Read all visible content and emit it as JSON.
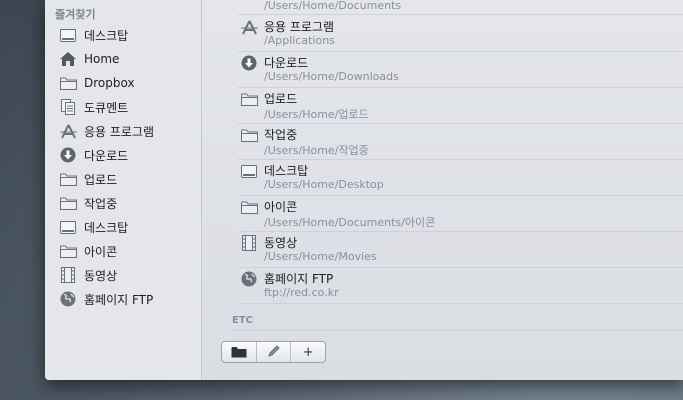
{
  "sidebar": {
    "heading": "즐겨찾기",
    "items": [
      {
        "label": "데스크탑",
        "icon": "desktop-icon"
      },
      {
        "label": "Home",
        "icon": "home-icon"
      },
      {
        "label": "Dropbox",
        "icon": "folder-icon"
      },
      {
        "label": "도큐멘트",
        "icon": "documents-icon"
      },
      {
        "label": "응용 프로그램",
        "icon": "applications-icon"
      },
      {
        "label": "다운로드",
        "icon": "downloads-icon"
      },
      {
        "label": "업로드",
        "icon": "folder-icon"
      },
      {
        "label": "작업중",
        "icon": "folder-icon"
      },
      {
        "label": "데스크탑",
        "icon": "desktop-icon"
      },
      {
        "label": "아이콘",
        "icon": "folder-icon"
      },
      {
        "label": "동영상",
        "icon": "movies-icon"
      },
      {
        "label": "홈페이지 FTP",
        "icon": "globe-icon"
      }
    ]
  },
  "main": {
    "first_path": "/Users/Home/Documents",
    "rows": [
      {
        "name": "응용 프로그램",
        "path": "/Applications",
        "icon": "applications-icon"
      },
      {
        "name": "다운로드",
        "path": "/Users/Home/Downloads",
        "icon": "downloads-icon"
      },
      {
        "name": "업로드",
        "path": "/Users/Home/업로드",
        "icon": "folder-icon"
      },
      {
        "name": "작업중",
        "path": "/Users/Home/작업중",
        "icon": "folder-icon"
      },
      {
        "name": "데스크탑",
        "path": "/Users/Home/Desktop",
        "icon": "desktop-icon"
      },
      {
        "name": "아이콘",
        "path": "/Users/Home/Documents/아이콘",
        "icon": "folder-icon"
      },
      {
        "name": "동영상",
        "path": "/Users/Home/Movies",
        "icon": "movies-icon"
      },
      {
        "name": "홈페이지 FTP",
        "path": "ftp://red.co.kr",
        "icon": "globe-icon"
      }
    ],
    "section_label": "ETC"
  },
  "toolbar": {
    "buttons": [
      {
        "icon": "folder-icon"
      },
      {
        "icon": "pencil-icon"
      },
      {
        "icon": "add-icon",
        "glyph": "+"
      }
    ]
  },
  "colors": {
    "window_bg": "#e7e9ed",
    "text": "#1e1e1e",
    "secondary_text": "#8a8f97",
    "icon_gray": "#6b7079"
  }
}
